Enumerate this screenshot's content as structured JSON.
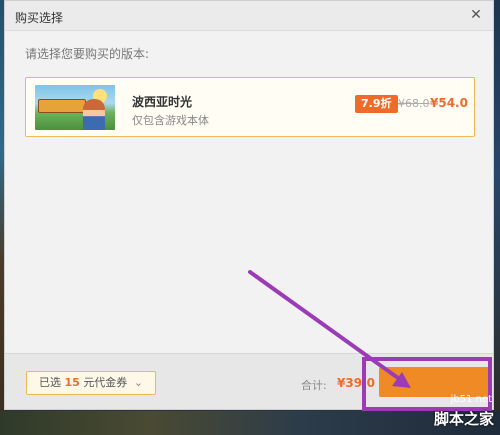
{
  "dialog": {
    "title": "购买选择",
    "close_icon": "close-icon",
    "prompt": "请选择您要购买的版本:"
  },
  "version": {
    "thumb_icon": "game-thumbnail",
    "name": "波西亚时光",
    "description": "仅包含游戏本体",
    "discount": "7.9折",
    "original_price": "¥68.0",
    "sale_price": "¥54.0"
  },
  "footer": {
    "coupon_prefix": "已选",
    "coupon_amount": "15",
    "coupon_suffix": "元代金券",
    "coupon_chevron": "⌄",
    "total_label": "合计:",
    "total_value": "¥39.0"
  },
  "watermark": {
    "site": "jb51.net",
    "brand": "脚本之家"
  },
  "colors": {
    "accent": "#ee6b2a",
    "annotation": "#9b3bb5",
    "card_border": "#f0b856"
  }
}
